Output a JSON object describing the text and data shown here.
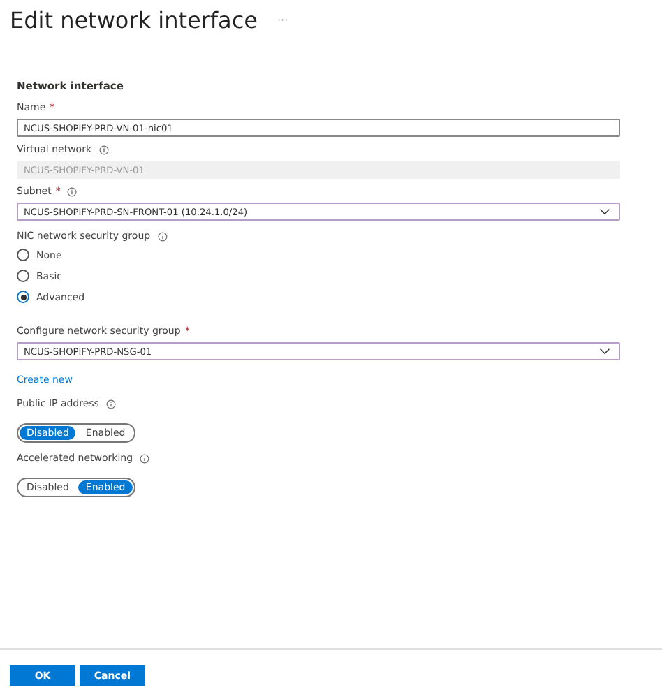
{
  "title": "Edit network interface",
  "more": "···",
  "section": "Network interface",
  "name_field": {
    "label": "Name",
    "required": "*",
    "value": "NCUS-SHOPIFY-PRD-VN-01-nic01"
  },
  "virtual_network": {
    "label": "Virtual network",
    "info": true,
    "value": "NCUS-SHOPIFY-PRD-VN-01",
    "disabled": true
  },
  "subnet": {
    "label": "Subnet",
    "required": "*",
    "info": true,
    "value": "NCUS-SHOPIFY-PRD-SN-FRONT-01 (10.24.1.0/24)"
  },
  "nsg": {
    "label": "NIC network security group",
    "info": true,
    "options": [
      {
        "label": "None",
        "selected": false
      },
      {
        "label": "Basic",
        "selected": false
      },
      {
        "label": "Advanced",
        "selected": true
      }
    ]
  },
  "configure_nsg": {
    "label": "Configure network security group",
    "required": "*",
    "value": "NCUS-SHOPIFY-PRD-NSG-01",
    "link": "Create new"
  },
  "toggles": [
    {
      "label": "Public IP address",
      "options": [
        {
          "label": "Disabled",
          "selected": true
        },
        {
          "label": "Enabled",
          "selected": false
        }
      ]
    },
    {
      "label": "Accelerated networking",
      "options": [
        {
          "label": "Disabled",
          "selected": false
        },
        {
          "label": "Enabled",
          "selected": true
        }
      ]
    }
  ],
  "buttons": [
    "OK",
    "Cancel"
  ]
}
